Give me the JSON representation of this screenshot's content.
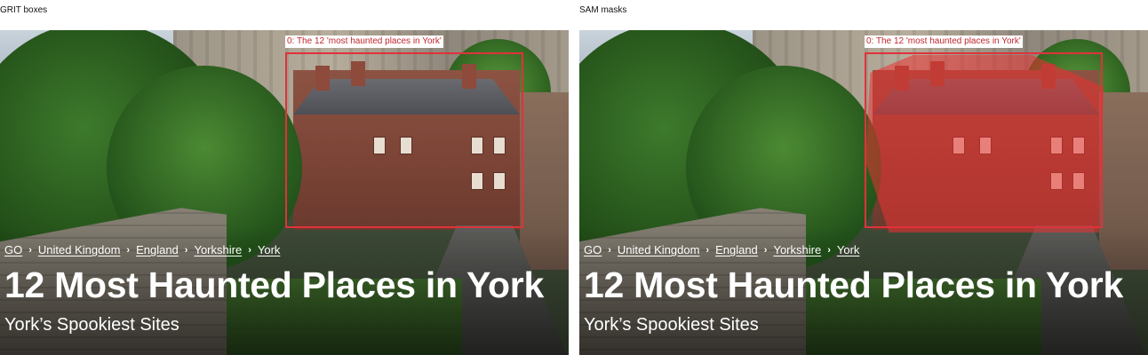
{
  "panels": [
    {
      "title": "GRIT boxes",
      "box_label": "0: The 12 'most haunted places in York'",
      "breadcrumbs": [
        "GO",
        "United Kingdom",
        "England",
        "Yorkshire",
        "York"
      ],
      "headline": "12 Most Haunted Places in York",
      "subheadline": "York’s Spookiest Sites",
      "show_mask": false
    },
    {
      "title": "SAM masks",
      "box_label": "0: The 12 'most haunted places in York'",
      "breadcrumbs": [
        "GO",
        "United Kingdom",
        "England",
        "Yorkshire",
        "York"
      ],
      "headline": "12 Most Haunted Places in York",
      "subheadline": "York’s Spookiest Sites",
      "show_mask": true
    }
  ],
  "breadcrumb_separator": "›",
  "colors": {
    "box": "#e0323a",
    "mask": "#eb3232"
  }
}
